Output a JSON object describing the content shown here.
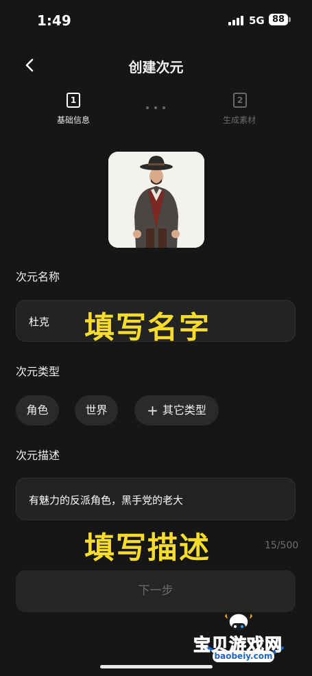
{
  "status_bar": {
    "time": "1:49",
    "network": "5G",
    "battery": "88"
  },
  "header": {
    "title": "创建次元"
  },
  "steps": [
    {
      "number": "1",
      "label": "基础信息",
      "active": true
    },
    {
      "number": "2",
      "label": "生成素材",
      "active": false
    }
  ],
  "name_section": {
    "label": "次元名称",
    "value": "杜克",
    "overlay": "填写名字"
  },
  "type_section": {
    "label": "次元类型",
    "options": [
      "角色",
      "世界",
      "其它类型"
    ]
  },
  "desc_section": {
    "label": "次元描述",
    "value": "有魅力的反派角色，黑手党的老大",
    "overlay": "填写描述",
    "counter": "15/500"
  },
  "next_button": {
    "label": "下一步"
  },
  "watermark": {
    "text": "宝贝游戏网",
    "url": "baobeiy.com"
  },
  "colors": {
    "background": "#161616",
    "overlay_yellow": "#f7dc2d",
    "field_bg": "#232323"
  }
}
